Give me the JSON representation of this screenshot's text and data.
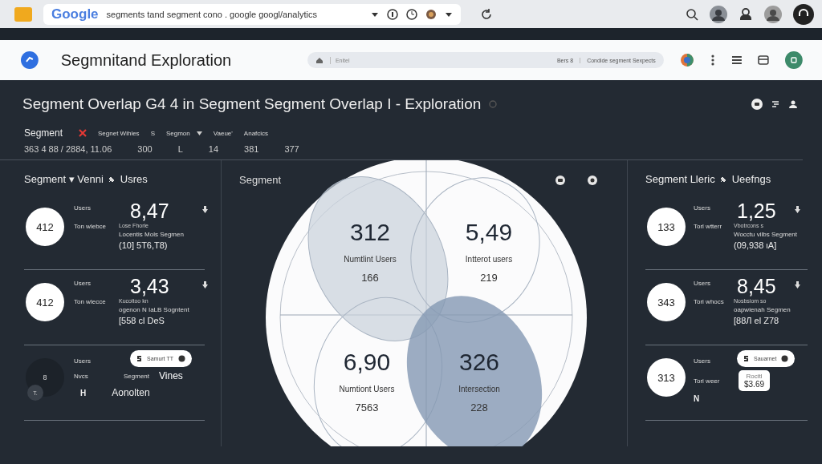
{
  "browser": {
    "logo": "Google",
    "address": "segments tand segment cono . google googl/analytics"
  },
  "app_header": {
    "title": "Segmnitand Exploration",
    "search": {
      "placeholder": "Enitel",
      "count": "Bers 8",
      "scope": "Condide segment Sexpects"
    }
  },
  "page_title": "Segment Overlap G4 4  in Segment Segment Overlap I - Exploration",
  "segment_bar": {
    "label": "Segment",
    "items": [
      {
        "text": "Segnet Wihles",
        "dropdown": false
      },
      {
        "text": "S",
        "dropdown": false
      },
      {
        "text": "Segmon",
        "dropdown": true
      },
      {
        "text": "Vaeue'",
        "dropdown": false
      },
      {
        "text": "Anafcics",
        "dropdown": false
      }
    ]
  },
  "numbers_row": [
    "363 4  88 / 2884, 11.06",
    "300",
    "L",
    "14",
    "381",
    "377"
  ],
  "panels": [
    {
      "title": "Segment ▾ Venni",
      "suffix": "Usres",
      "cards": [
        {
          "kind": "metric",
          "badge": "412",
          "badge_filled": true,
          "label": "Users",
          "value": "8,47",
          "sublabel": "Ton  wlebce",
          "desc": "Lose Fhorie",
          "note": "Locentis Mols Segmen",
          "range": "(10] 5T6,T8)"
        },
        {
          "kind": "metric",
          "badge": "412",
          "badge_filled": true,
          "label": "Users",
          "value": "3,43",
          "sublabel": "Ton  wlecce",
          "desc": "Kucoltoo kn",
          "note": "ogenon N IaLB Sogntent",
          "range": "[558 cl DeS"
        },
        {
          "kind": "chip",
          "badge": "8",
          "badge_filled": false,
          "label": "Users",
          "chip": "Samurt TT",
          "sublabel": "Nvcs",
          "mid": "Segment",
          "value": "Vines",
          "avatar": "T.",
          "footer": "H",
          "footer_text": "Aonolten"
        }
      ]
    },
    {
      "title": "Segment Lleric",
      "suffix": "Ueefngs",
      "cards": [
        {
          "kind": "metric",
          "badge": "133",
          "badge_filled": true,
          "label": "Users",
          "value": "1,25",
          "sublabel": "Torl  wtterr",
          "desc": "Vbotrcons s",
          "note": "Wocctu vilbs Segment",
          "range": "(09,938 ιA]"
        },
        {
          "kind": "metric",
          "badge": "343",
          "badge_filled": true,
          "label": "Users",
          "value": "8,45",
          "sublabel": "Tori  whocs",
          "desc": "Nosbsiom so",
          "note": "oapwienah Segmen",
          "range": "[88Л el Z78"
        },
        {
          "kind": "chip",
          "badge": "313",
          "badge_filled": true,
          "label": "Users",
          "chip": "Sauarnet",
          "sublabel": "Tori  weer",
          "box_label": "Rocitl",
          "box_value": "$3.69",
          "footer": "N"
        }
      ]
    }
  ],
  "venn": {
    "title": "Segment",
    "regions": [
      {
        "value": "312",
        "label": "Numtlint Users",
        "sub": "166"
      },
      {
        "value": "5,49",
        "label": "Intterot users",
        "sub": "219"
      },
      {
        "value": "6,90",
        "label": "Numtiont Users",
        "sub": "7563"
      },
      {
        "value": "326",
        "label": "Intersection",
        "sub": "228"
      }
    ]
  }
}
